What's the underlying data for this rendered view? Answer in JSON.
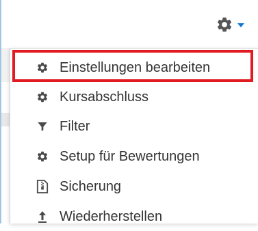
{
  "header": {
    "settings_toggle_icon": "gear-icon",
    "dropdown_caret_icon": "caret-down-icon",
    "caret_color": "#1177d1"
  },
  "menu": {
    "items": [
      {
        "label": "Einstellungen bearbeiten",
        "icon": "gear-icon",
        "highlighted": true
      },
      {
        "label": "Kursabschluss",
        "icon": "gear-icon"
      },
      {
        "label": "Filter",
        "icon": "filter-icon"
      },
      {
        "label": "Setup für Bewertungen",
        "icon": "gear-icon"
      },
      {
        "label": "Sicherung",
        "icon": "file-archive-icon"
      },
      {
        "label": "Wiederherstellen",
        "icon": "upload-arrow-icon"
      }
    ],
    "highlight_color": "#e01b22"
  }
}
